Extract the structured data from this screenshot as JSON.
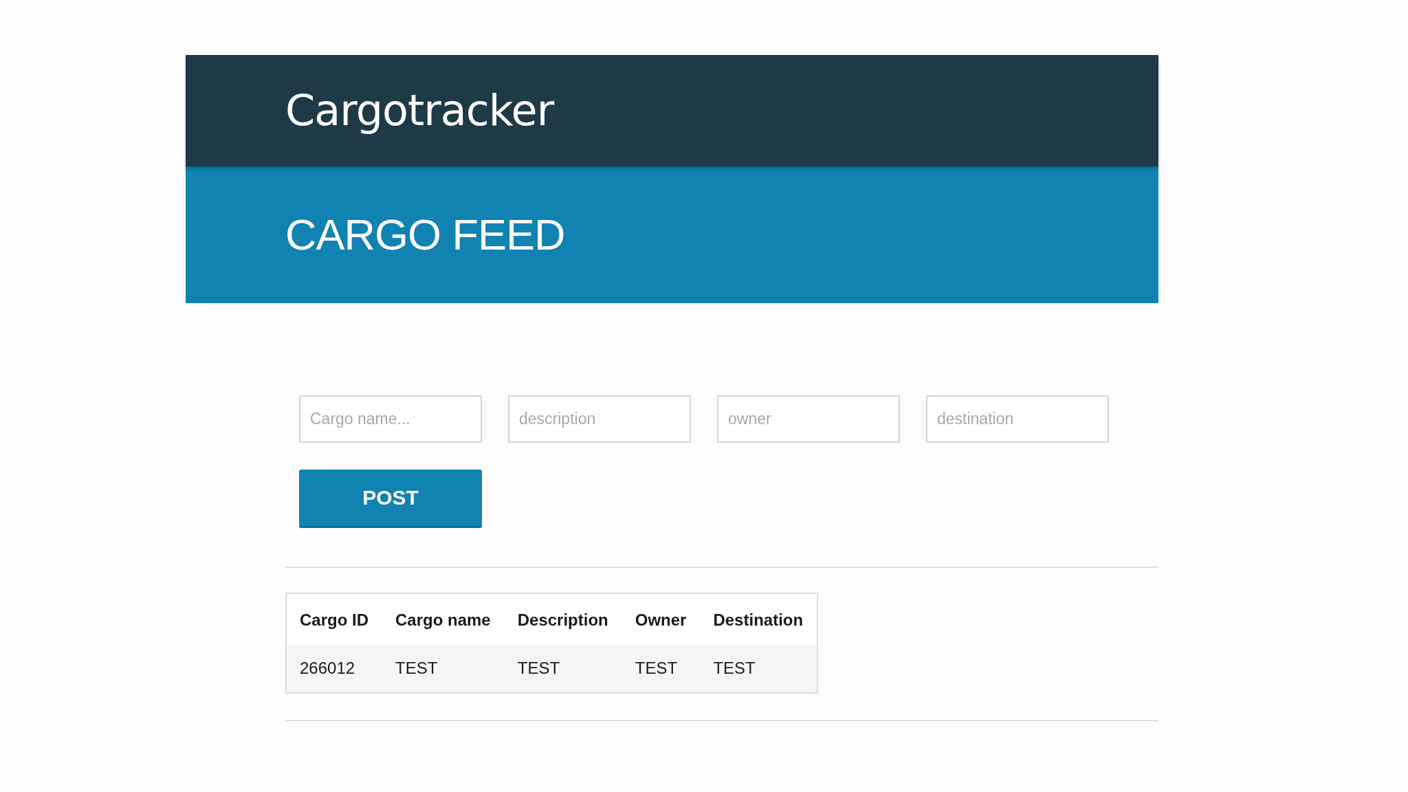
{
  "header": {
    "title": "Cargotracker"
  },
  "banner": {
    "heading": "CARGO FEED"
  },
  "form": {
    "fields": [
      {
        "placeholder": "Cargo name..."
      },
      {
        "placeholder": "description"
      },
      {
        "placeholder": "owner"
      },
      {
        "placeholder": "destination"
      }
    ],
    "submit_button": "POST"
  },
  "table": {
    "columns": [
      "Cargo ID",
      "Cargo name",
      "Description",
      "Owner",
      "Destination"
    ],
    "rows": [
      [
        "266012",
        "TEST",
        "TEST",
        "TEST",
        "TEST"
      ]
    ]
  }
}
